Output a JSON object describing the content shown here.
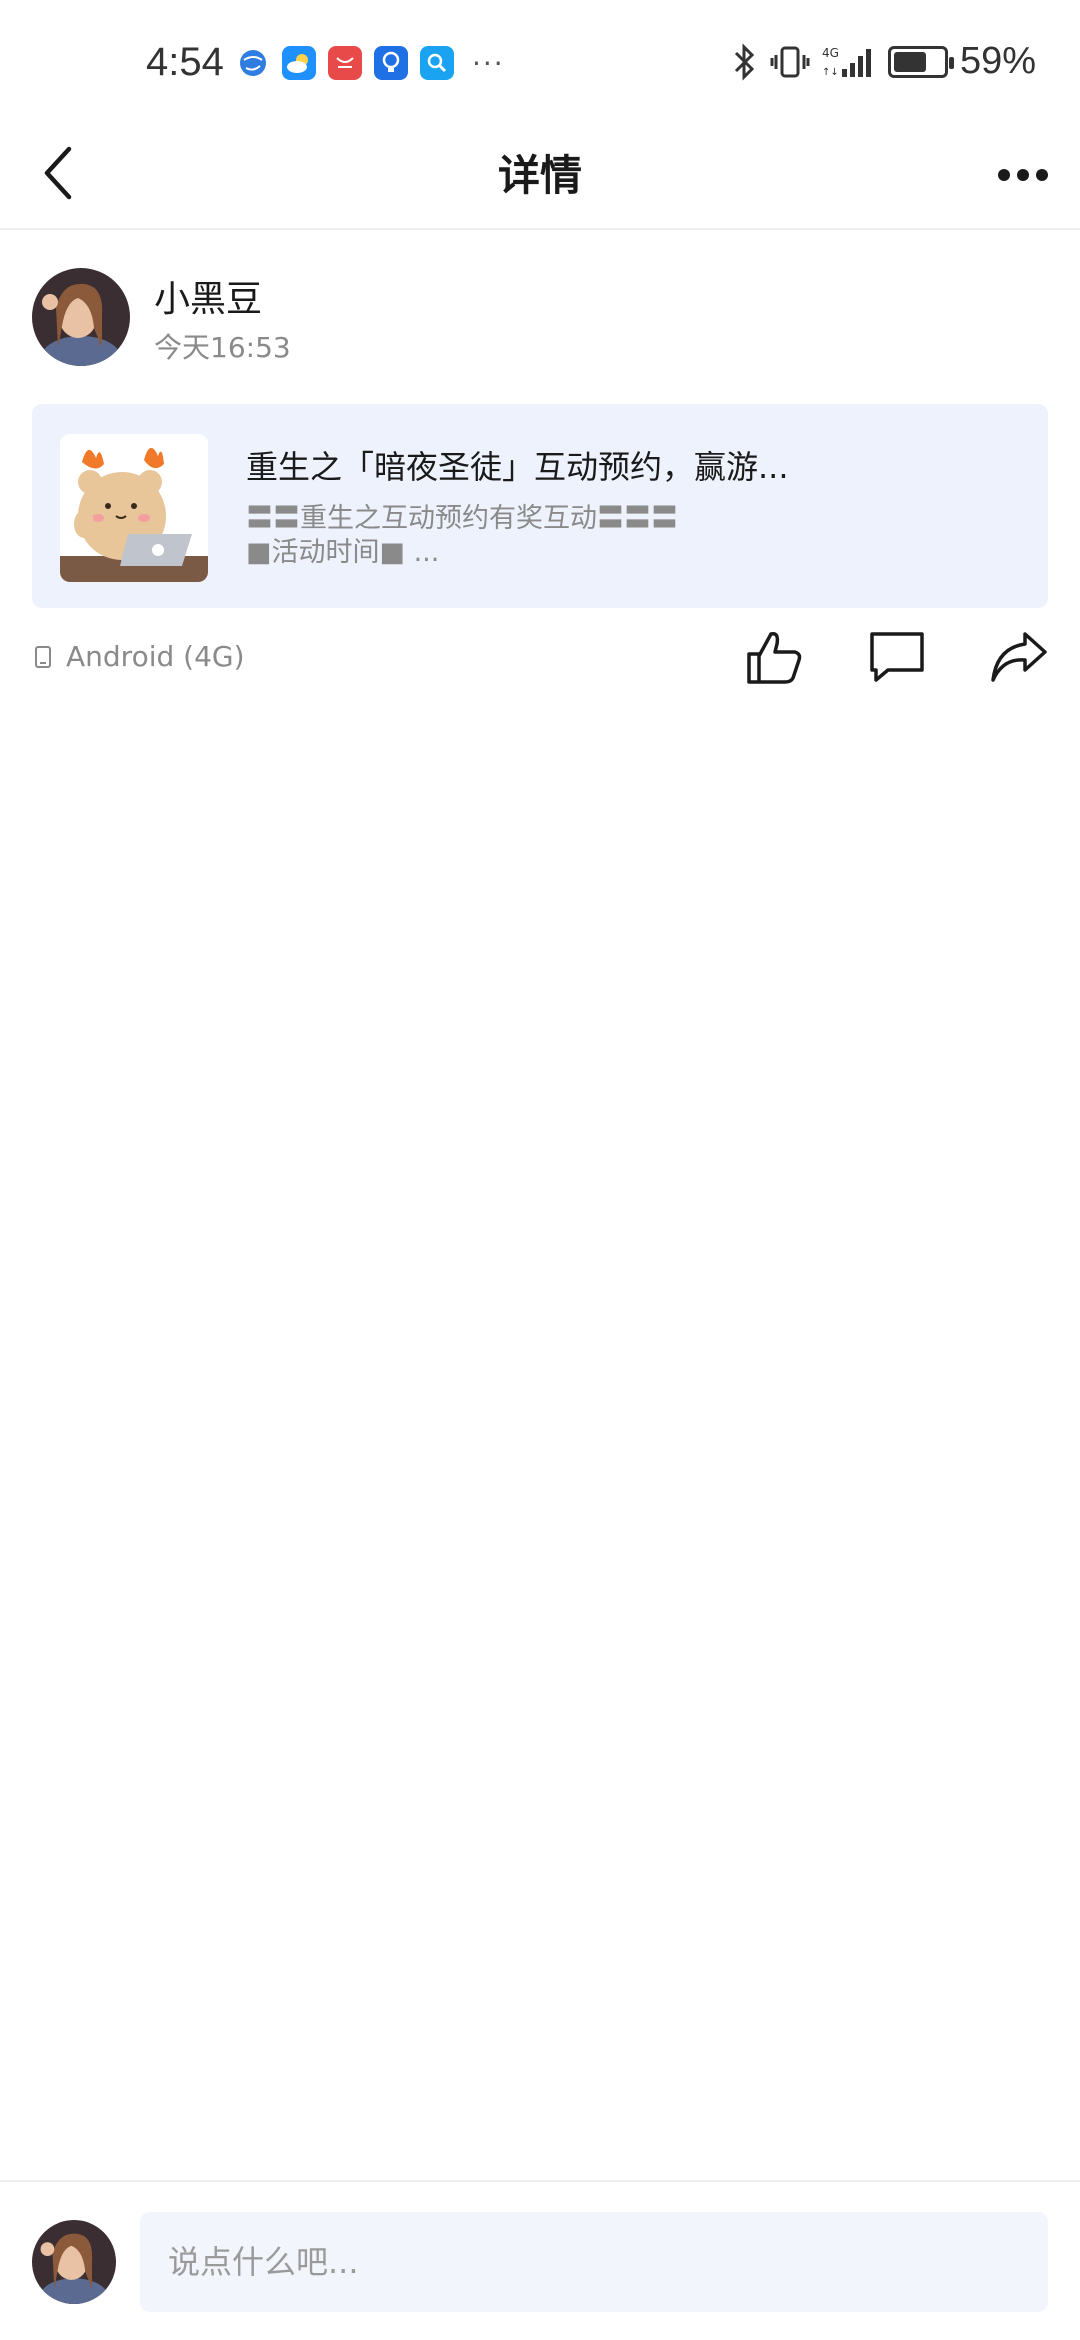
{
  "status_bar": {
    "time": "4:54",
    "notifications": [
      {
        "icon": "browser-icon",
        "color": "#2f7de1"
      },
      {
        "icon": "weather-icon",
        "color": "#1e90ff"
      },
      {
        "icon": "huawei-store-icon",
        "color": "#e84a4a"
      },
      {
        "icon": "tips-icon",
        "color": "#1f6fe5"
      },
      {
        "icon": "search-app-icon",
        "color": "#1aa3f0"
      }
    ],
    "more": "···",
    "battery_level": 0.59,
    "battery": "59%"
  },
  "header": {
    "title": "详情"
  },
  "post": {
    "username": "小黑豆",
    "time": "今天16:53",
    "card": {
      "title": "重生之「暗夜圣徒」互动预约，赢游...",
      "desc_line1": "〓〓重生之互动预约有奖互动〓〓〓",
      "desc_line2": "■活动时间■ ..."
    },
    "device": "Android (4G)"
  },
  "bottom": {
    "placeholder": "说点什么吧..."
  }
}
